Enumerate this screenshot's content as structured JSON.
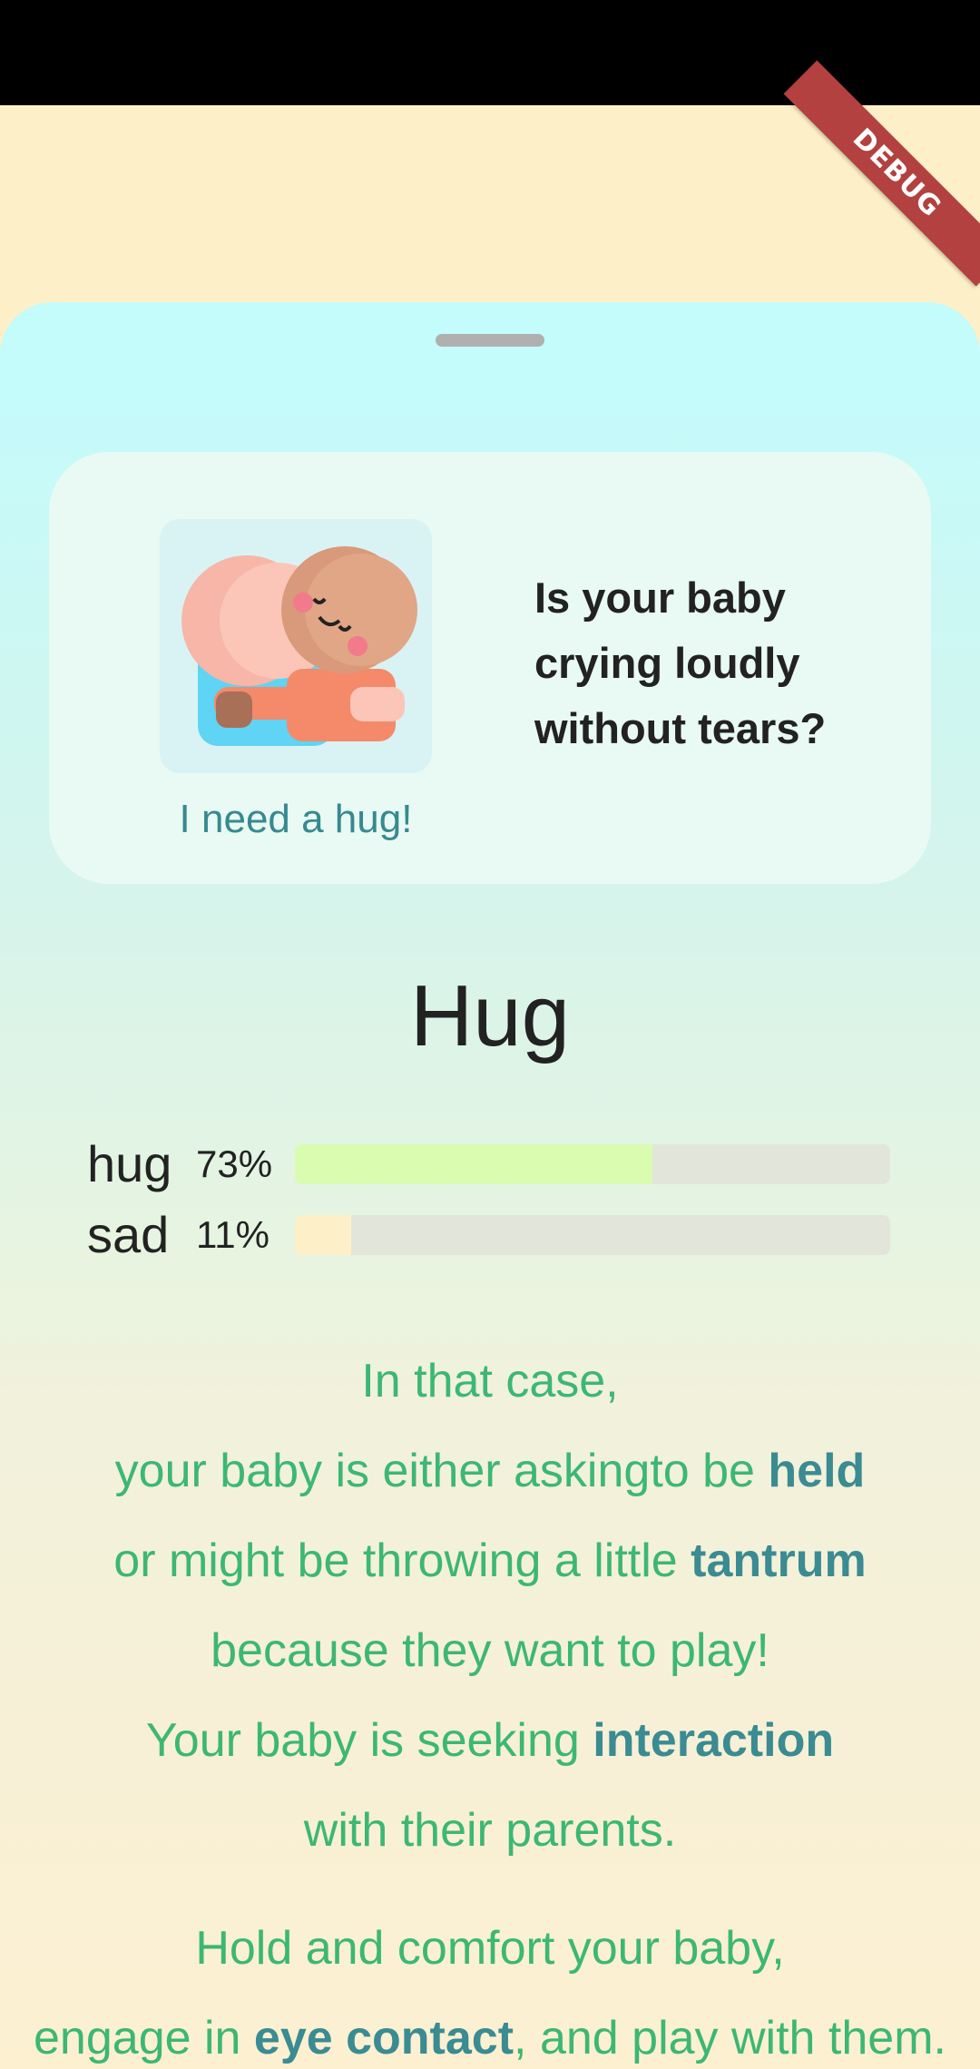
{
  "debug_banner": "DEBUG",
  "card": {
    "image_name": "baby-hug-illustration",
    "caption": "I need a hug!",
    "question": "Is your baby crying loudly without tears?"
  },
  "result": {
    "title": "Hug",
    "bars": [
      {
        "label": "hug",
        "percent_text": "73%",
        "fill_fraction": 0.6,
        "color": "#dafcb0"
      },
      {
        "label": "sad",
        "percent_text": "11%",
        "fill_fraction": 0.095,
        "color": "#fdf0c8"
      }
    ]
  },
  "advice": {
    "line1": "In that case,",
    "line2_a": "your baby is either askingto be ",
    "line2_b": "held",
    "line3_a": "or might be throwing a little ",
    "line3_b": "tantrum",
    "line4": "because they want to play!",
    "line5_a": "Your baby is seeking ",
    "line5_b": "interaction",
    "line6": "with their parents.",
    "line7": "Hold and comfort your baby,",
    "line8_a": "engage in ",
    "line8_b": "eye contact",
    "line8_c": ", and play with them."
  },
  "colors": {
    "accent_green": "#3cb774",
    "accent_teal": "#3a8b92",
    "debug_red": "#b2413f"
  }
}
